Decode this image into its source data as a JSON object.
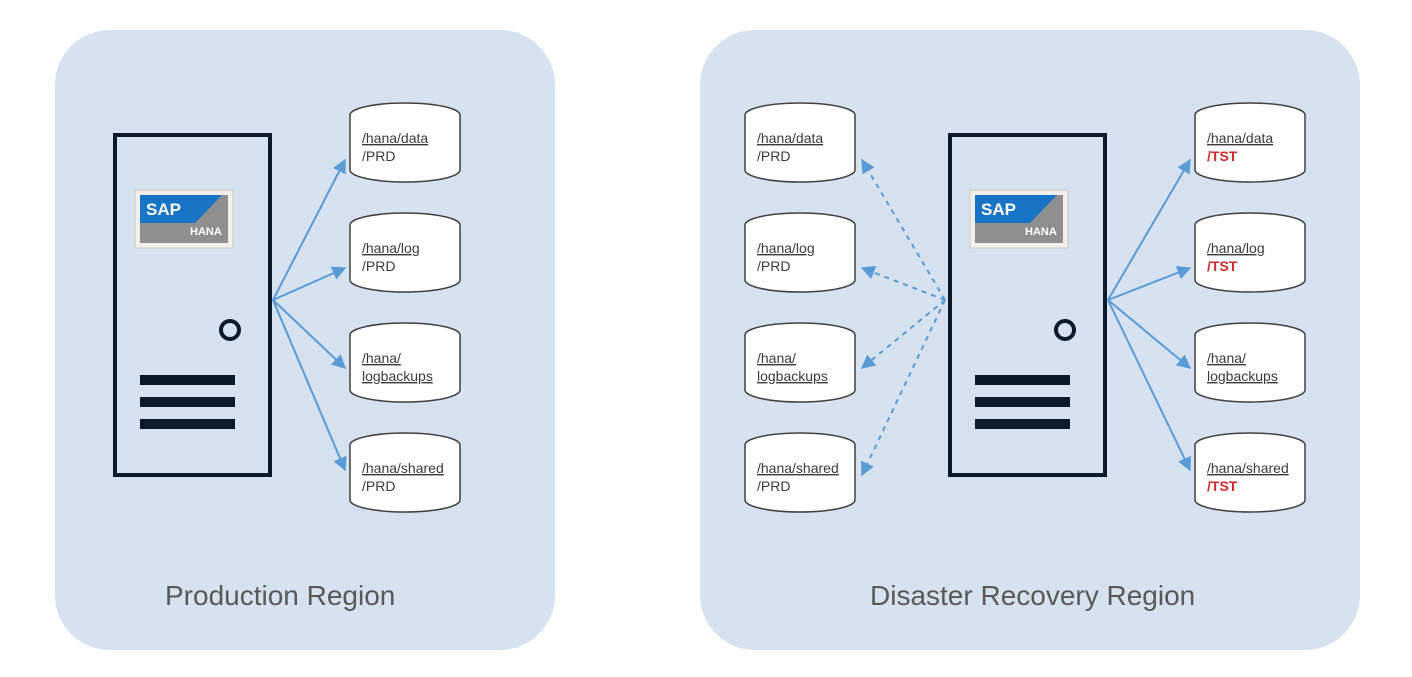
{
  "regions": {
    "production": {
      "label": "Production Region"
    },
    "dr": {
      "label": "Disaster Recovery Region"
    }
  },
  "sap_logo": {
    "brand": "SAP",
    "sub": "HANA"
  },
  "prod_volumes": [
    {
      "line1": "/hana/data",
      "line2": "/PRD"
    },
    {
      "line1": "/hana/log",
      "line2": "/PRD"
    },
    {
      "line1": "/hana/",
      "line2": "logbackups"
    },
    {
      "line1": "/hana/shared",
      "line2": "/PRD"
    }
  ],
  "dr_left_volumes": [
    {
      "line1": "/hana/data",
      "line2": "/PRD"
    },
    {
      "line1": "/hana/log",
      "line2": "/PRD"
    },
    {
      "line1": "/hana/",
      "line2": "logbackups"
    },
    {
      "line1": "/hana/shared",
      "line2": "/PRD"
    }
  ],
  "dr_right_volumes": [
    {
      "line1": "/hana/data",
      "line2": "/TST",
      "highlight": true
    },
    {
      "line1": "/hana/log",
      "line2": "/TST",
      "highlight": true
    },
    {
      "line1": "/hana/",
      "line2": "logbackups",
      "highlight": false
    },
    {
      "line1": "/hana/shared",
      "line2": "/TST",
      "highlight": true
    }
  ],
  "colors": {
    "region_bg": "#d6e2ef",
    "arrow_solid": "#5b9bd5",
    "arrow_dashed": "#5b9bd5",
    "server_stroke": "#0b1a2b",
    "cyl_stroke": "#414141",
    "sap_blue": "#1874c4",
    "sap_grey": "#8f8f8f"
  }
}
